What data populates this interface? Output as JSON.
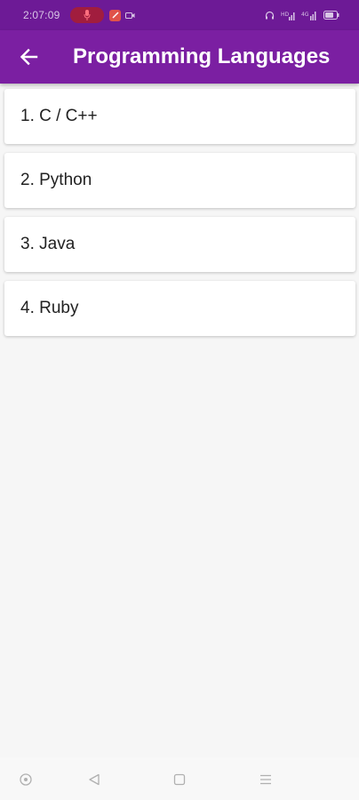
{
  "status_bar": {
    "time": "2:07:09",
    "signal_text": "4G",
    "colors": {
      "background": "#6d1a96",
      "mic_pill": "#a11d3e"
    }
  },
  "app_bar": {
    "title": "Programming Languages",
    "back_icon": "arrow-left-icon",
    "color": "#7b1fa2"
  },
  "list": {
    "items": [
      {
        "label": "1. C / C++"
      },
      {
        "label": "2. Python"
      },
      {
        "label": "3. Java"
      },
      {
        "label": "4. Ruby"
      }
    ]
  },
  "nav_bar": {
    "icons": [
      "assistant-circle-icon",
      "back-triangle-icon",
      "home-square-icon",
      "menu-lines-icon"
    ]
  }
}
